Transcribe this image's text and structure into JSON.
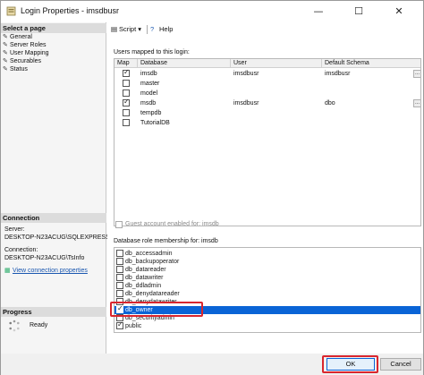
{
  "window": {
    "title": "Login Properties - imsdbusr",
    "min_glyph": "—",
    "max_glyph": "☐",
    "close_glyph": "✕"
  },
  "left": {
    "select_page_header": "Select a page",
    "pages": [
      "General",
      "Server Roles",
      "User Mapping",
      "Securables",
      "Status"
    ],
    "connection_header": "Connection",
    "server_label": "Server:",
    "server_value": "DESKTOP-N23ACUG\\SQLEXPRESS",
    "connection_label": "Connection:",
    "connection_value": "DESKTOP-N23ACUG\\TsInfo",
    "view_connection_link": "View connection properties",
    "progress_header": "Progress",
    "progress_status": "Ready"
  },
  "toolbar": {
    "script_label": "Script",
    "help_label": "Help"
  },
  "users_mapped": {
    "label": "Users mapped to this login:",
    "columns": [
      "Map",
      "Database",
      "User",
      "Default Schema"
    ],
    "rows": [
      {
        "map": true,
        "database": "imsdb",
        "user": "imsdbusr",
        "schema": "imsdbusr",
        "ellipsis": true
      },
      {
        "map": false,
        "database": "master",
        "user": "",
        "schema": "",
        "ellipsis": false
      },
      {
        "map": false,
        "database": "model",
        "user": "",
        "schema": "",
        "ellipsis": false
      },
      {
        "map": true,
        "database": "msdb",
        "user": "imsdbusr",
        "schema": "dbo",
        "ellipsis": true
      },
      {
        "map": false,
        "database": "tempdb",
        "user": "",
        "schema": "",
        "ellipsis": false
      },
      {
        "map": false,
        "database": "TutorialDB",
        "user": "",
        "schema": "",
        "ellipsis": false
      }
    ],
    "ellipsis_glyph": "..."
  },
  "guest": {
    "label": "Guest account enabled for: imsdb",
    "checked": false
  },
  "role_membership": {
    "label": "Database role membership for: imsdb",
    "roles": [
      {
        "name": "db_accessadmin",
        "checked": false,
        "selected": false
      },
      {
        "name": "db_backupoperator",
        "checked": false,
        "selected": false
      },
      {
        "name": "db_datareader",
        "checked": false,
        "selected": false
      },
      {
        "name": "db_datawriter",
        "checked": false,
        "selected": false
      },
      {
        "name": "db_ddladmin",
        "checked": false,
        "selected": false
      },
      {
        "name": "db_denydatareader",
        "checked": false,
        "selected": false
      },
      {
        "name": "db_denydatawriter",
        "checked": false,
        "selected": false
      },
      {
        "name": "db_owner",
        "checked": true,
        "selected": true
      },
      {
        "name": "db_securityadmin",
        "checked": false,
        "selected": false
      },
      {
        "name": "public",
        "checked": true,
        "selected": false
      }
    ]
  },
  "buttons": {
    "ok_label": "OK",
    "cancel_label": "Cancel"
  },
  "colors": {
    "selection": "#0a64d6",
    "highlight_box": "#d9262e",
    "link": "#1a57b0"
  }
}
